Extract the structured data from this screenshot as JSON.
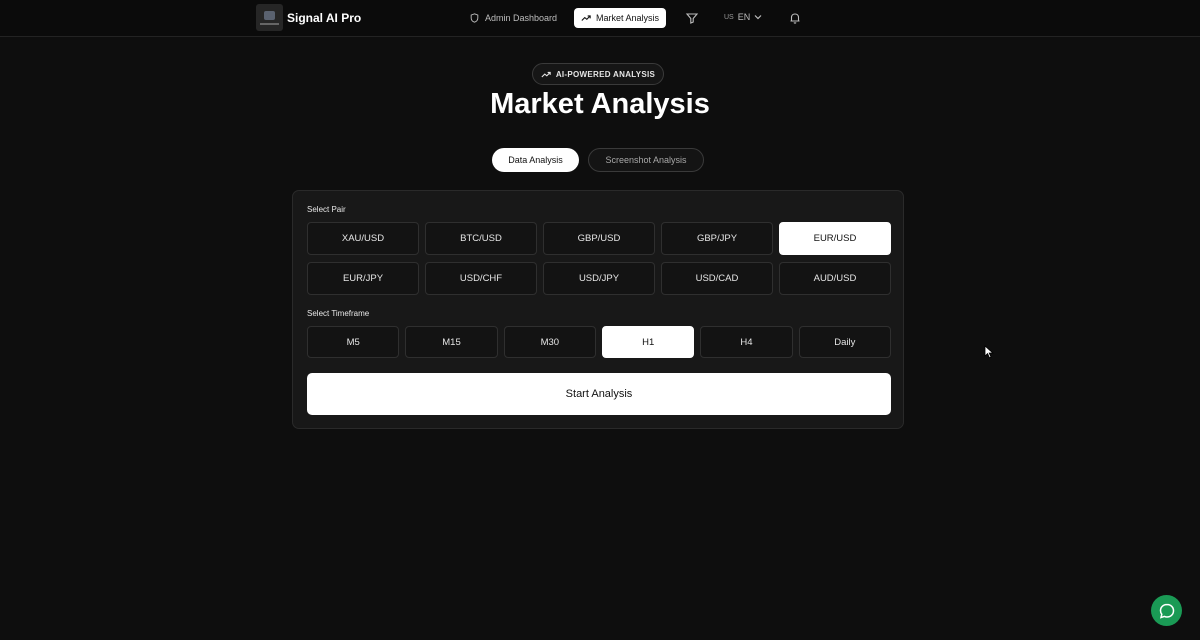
{
  "header": {
    "brand": "Signal AI Pro",
    "nav": {
      "admin_label": "Admin Dashboard",
      "market_label": "Market Analysis",
      "lang_flag": "US",
      "lang_label": "EN"
    }
  },
  "hero": {
    "badge": "AI-POWERED ANALYSIS",
    "title": "Market Analysis"
  },
  "tabs": [
    {
      "label": "Data Analysis",
      "active": true
    },
    {
      "label": "Screenshot Analysis",
      "active": false
    }
  ],
  "form": {
    "pair_label": "Select Pair",
    "pairs": [
      "XAU/USD",
      "BTC/USD",
      "GBP/USD",
      "GBP/JPY",
      "EUR/USD",
      "EUR/JPY",
      "USD/CHF",
      "USD/JPY",
      "USD/CAD",
      "AUD/USD"
    ],
    "selected_pair": "EUR/USD",
    "timeframe_label": "Select Timeframe",
    "timeframes": [
      "M5",
      "M15",
      "M30",
      "H1",
      "H4",
      "Daily"
    ],
    "selected_timeframe": "H1",
    "start_label": "Start Analysis"
  },
  "icons": {
    "admin": "shield-icon",
    "market": "trending-up-icon",
    "filter": "filter-icon",
    "lang_chevron": "chevron-down-icon",
    "bell": "bell-icon",
    "chat": "chat-bubble-icon"
  },
  "colors": {
    "background": "#0e0e0e",
    "card": "#181818",
    "selected": "#ffffff",
    "chat_fab": "#1a9a55"
  }
}
